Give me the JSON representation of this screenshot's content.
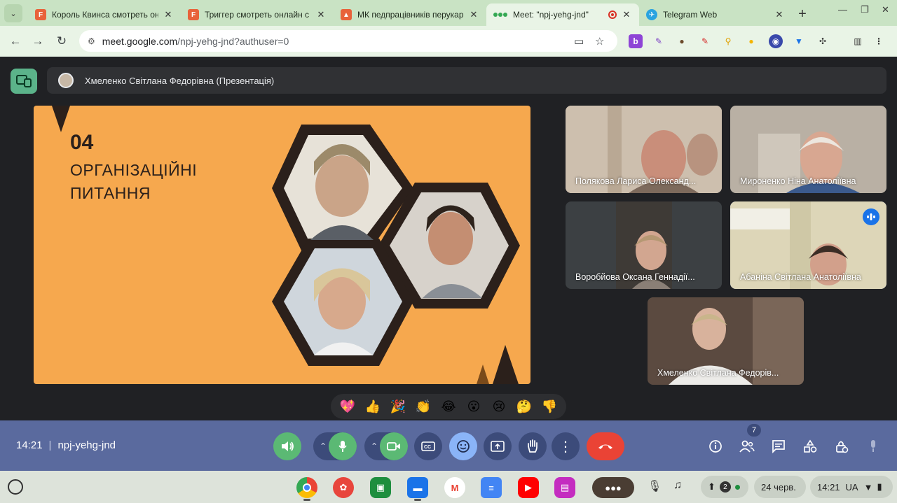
{
  "browser": {
    "tabs": [
      {
        "title": "Король Квинса смотреть он",
        "favicon_color": "#e8623a",
        "favicon_letter": "F",
        "active": false
      },
      {
        "title": "Триггер смотреть онлайн с",
        "favicon_color": "#e8623a",
        "favicon_letter": "F",
        "active": false
      },
      {
        "title": "МК педпрацівників перукар",
        "favicon_color": "#e8623a",
        "favicon_letter": "▲",
        "active": false
      },
      {
        "title": "Meet: \"npj-yehg-jnd\"",
        "favicon_color": "#34a853",
        "favicon_letter": "",
        "active": true
      },
      {
        "title": "Telegram Web",
        "favicon_color": "#2aa3e0",
        "favicon_letter": "✈",
        "active": false
      }
    ],
    "url_host": "meet.google.com",
    "url_path": "/npj-yehg-jnd?authuser=0"
  },
  "meet": {
    "presenter_banner": "Хмеленко Світлана Федорівна (Презентація)",
    "slide": {
      "number": "04",
      "title_line1": "ОРГАНІЗАЦІЙНІ",
      "title_line2": "ПИТАННЯ"
    },
    "participants": [
      {
        "name": "Полякова Лариса Олександ..."
      },
      {
        "name": "Мироненко Ніна Анатоліївна"
      },
      {
        "name": "Воробйова Оксана Геннадії..."
      },
      {
        "name": "Абаніна Світлана Анатоліївна"
      },
      {
        "name": "Хмеленко Світлана Федорів..."
      }
    ],
    "reactions": [
      "💖",
      "👍",
      "🎉",
      "👏",
      "😂",
      "😮",
      "😢",
      "🤔",
      "👎"
    ],
    "controls": {
      "time": "14:21",
      "meeting_code": "npj-yehg-jnd",
      "participants_count": "7"
    }
  },
  "os_shelf": {
    "date": "24 черв.",
    "time": "14:21",
    "keyboard": "UA",
    "notifications": "2"
  }
}
